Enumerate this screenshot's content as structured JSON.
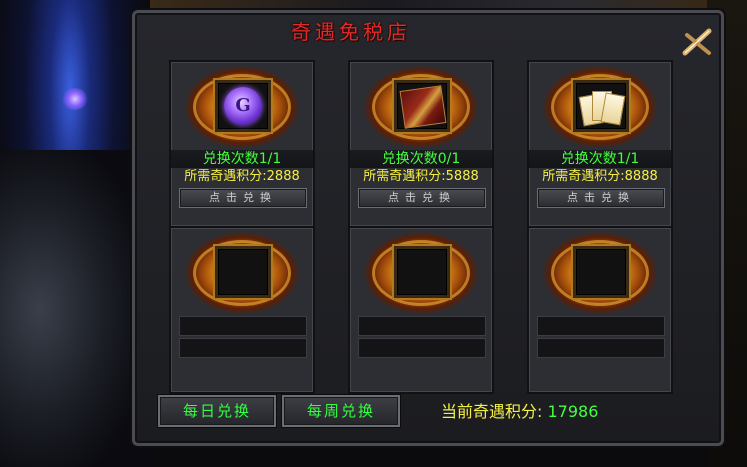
{
  "title": "奇遇免税店",
  "slots": [
    {
      "count": "兑换次数1/1",
      "cost": "所需奇遇积分:2888",
      "button": "点击兑换",
      "icon": "purple-orb-item",
      "orb_letter": "G"
    },
    {
      "count": "兑换次数0/1",
      "cost": "所需奇遇积分:5888",
      "button": "点击兑换",
      "icon": "red-scroll-item"
    },
    {
      "count": "兑换次数1/1",
      "cost": "所需奇遇积分:8888",
      "button": "点击兑换",
      "icon": "book-stack-item"
    }
  ],
  "tabs": {
    "daily": "每日兑换",
    "weekly": "每周兑换"
  },
  "points": {
    "label": "当前奇遇积分:",
    "value": "17986"
  },
  "colors": {
    "title": "#e22a2a",
    "count": "#42ff3c",
    "cost": "#f4f043"
  }
}
